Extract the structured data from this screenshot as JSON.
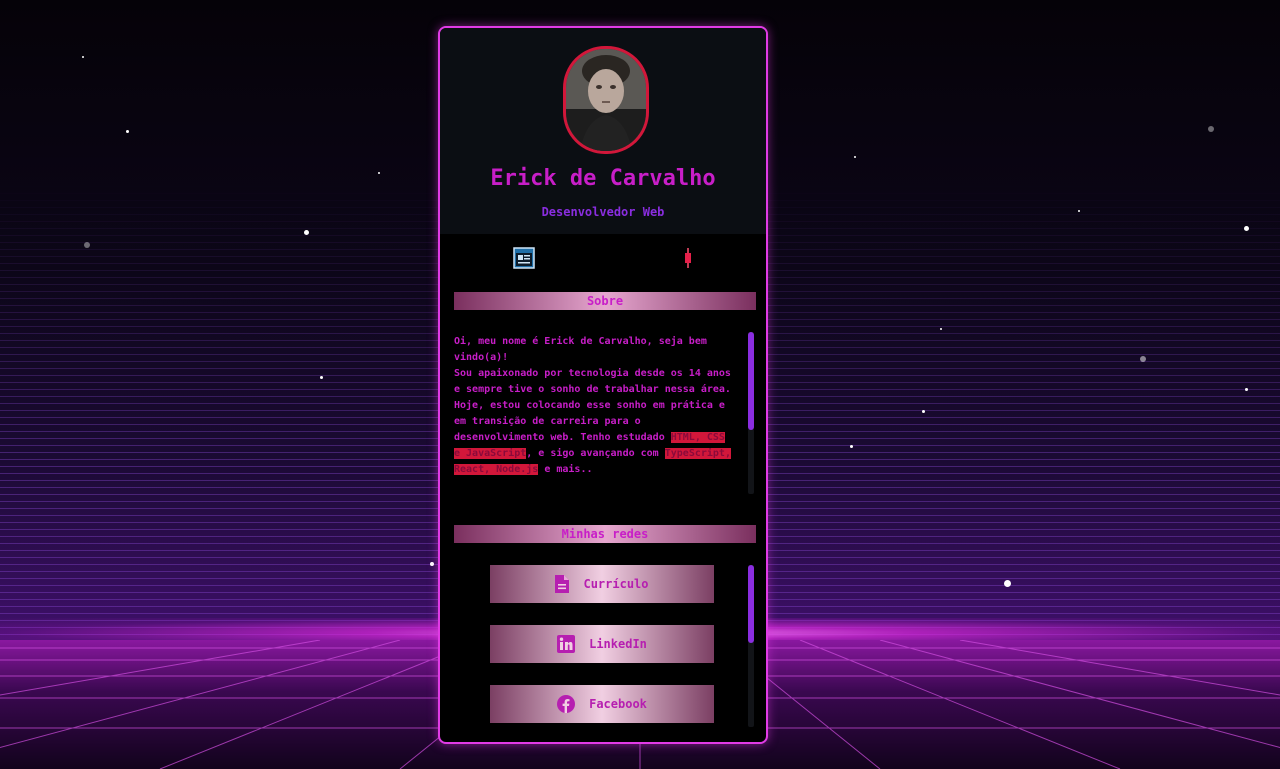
{
  "profile": {
    "name": "Erick de Carvalho",
    "role": "Desenvolvedor Web"
  },
  "tabs": [
    {
      "icon": "window-icon"
    },
    {
      "icon": "candle-icon"
    }
  ],
  "about": {
    "heading": "Sobre",
    "line1": "Oi, meu nome é Erick de Carvalho, seja bem vindo(a)!",
    "intro": "Sou apaixonado por tecnologia desde os 14 anos e sempre tive o sonho de trabalhar nessa área. Hoje, estou colocando esse sonho em prática e em transição de carreira para o desenvolvimento web. Tenho estudado ",
    "skills_current": "HTML, CSS e JavaScript",
    "middle": ", e sigo avançando com ",
    "skills_next": "TypeScript, React, Node.js",
    "end": " e mais.."
  },
  "networks": {
    "heading": "Minhas redes",
    "links": [
      {
        "label": "Currículo",
        "icon": "document-icon"
      },
      {
        "label": "LinkedIn",
        "icon": "linkedin-icon"
      },
      {
        "label": "Facebook",
        "icon": "facebook-icon"
      }
    ]
  },
  "colors": {
    "accent_pink": "#c81ec8",
    "accent_purple": "#8a2de0",
    "avatar_border": "#d2173a",
    "card_border": "#e13be6"
  }
}
